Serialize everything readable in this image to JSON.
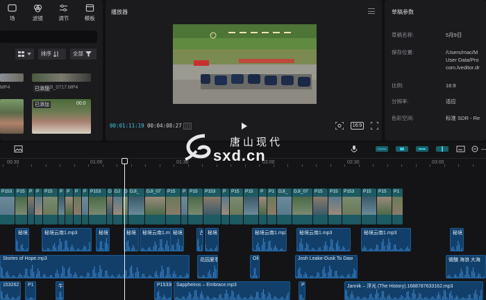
{
  "left_panel": {
    "toolbar": [
      {
        "label": "场",
        "icon": "grid-icon"
      },
      {
        "label": "滤镜",
        "icon": "filter-icon"
      },
      {
        "label": "调节",
        "icon": "sliders-icon"
      },
      {
        "label": "模板",
        "icon": "template-icon"
      }
    ],
    "sort_label": "排序",
    "all_label": "全部",
    "items": [
      {
        "caption": "MP4"
      },
      {
        "badge": "已添加",
        "caption": "DJI_0717.MP4"
      },
      {
        "caption": ""
      },
      {
        "badge": "已添加",
        "caption": "00:0"
      }
    ]
  },
  "player": {
    "title": "播放器",
    "current_time": "00:01:11:19",
    "total_time": "00:04:08:27",
    "ratio_label": "16:9"
  },
  "draft": {
    "title": "草稿参数",
    "rows": [
      {
        "label": "草稿名称:",
        "value": "5月9日"
      },
      {
        "label": "保存位置:",
        "value": "/Users/mac/M\nUser Data/Pro\ncom.lveditor.dr"
      },
      {
        "label": "比例:",
        "value": "16:9"
      },
      {
        "label": "分辨率:",
        "value": "适应"
      },
      {
        "label": "色彩空间:",
        "value": "标准 SDR - Re"
      }
    ]
  },
  "timeline": {
    "ruler_labels": [
      "00:30",
      "01:00",
      "01:30",
      "02:00",
      "02:30",
      "03:00"
    ],
    "video_labels": [
      "P153",
      "P15",
      "P",
      "P",
      "P15",
      "P",
      "P",
      "P",
      "P",
      "P153",
      "D",
      "DJ",
      "D",
      "DJI_",
      "DJI_07",
      "P15",
      "P",
      "P15",
      "P153",
      "P",
      "P15",
      "P15",
      "P",
      "P1",
      "DJI_",
      "DJI_07",
      "P15",
      "P15",
      "P153",
      "P15",
      "P15",
      "P1"
    ],
    "audio1": [
      {
        "label": "秘境"
      },
      {
        "label": "秘境云南1.mp3"
      },
      {
        "label": "秘境"
      },
      {
        "label": "秘境"
      },
      {
        "label": "秘境云南1.mp3"
      },
      {
        "label": "秘境"
      },
      {
        "label": "古"
      },
      {
        "label": "秘境"
      },
      {
        "label": "秘境云南1.mp3"
      },
      {
        "label": "秘境云南1.mp3"
      },
      {
        "label": "秘境云南1.mp3"
      },
      {
        "label": "秘境"
      }
    ],
    "audio2": [
      {
        "label": "Stories of Hope.mp3"
      },
      {
        "label": "花园夏季"
      },
      {
        "label": "Oli"
      },
      {
        "label": "Josh Leake-Dusk To Daw"
      },
      {
        "label": "微醺 海浪 大海"
      }
    ],
    "audio3": [
      {
        "label": "153262"
      },
      {
        "label": "P1"
      },
      {
        "label": "牛"
      },
      {
        "label": "P15330"
      },
      {
        "label": "Sappheiros – Embrace.mp3"
      },
      {
        "label": "P1"
      },
      {
        "label": "Jannik – 浮光 (The History).1688787633162.mp3"
      }
    ],
    "watermark_cn": "唐山现代",
    "watermark_en": "sxd.cn"
  },
  "colors": {
    "accent": "#3ec9e0",
    "video_clip": "#1d5a62",
    "audio_clip": "#123f69"
  }
}
